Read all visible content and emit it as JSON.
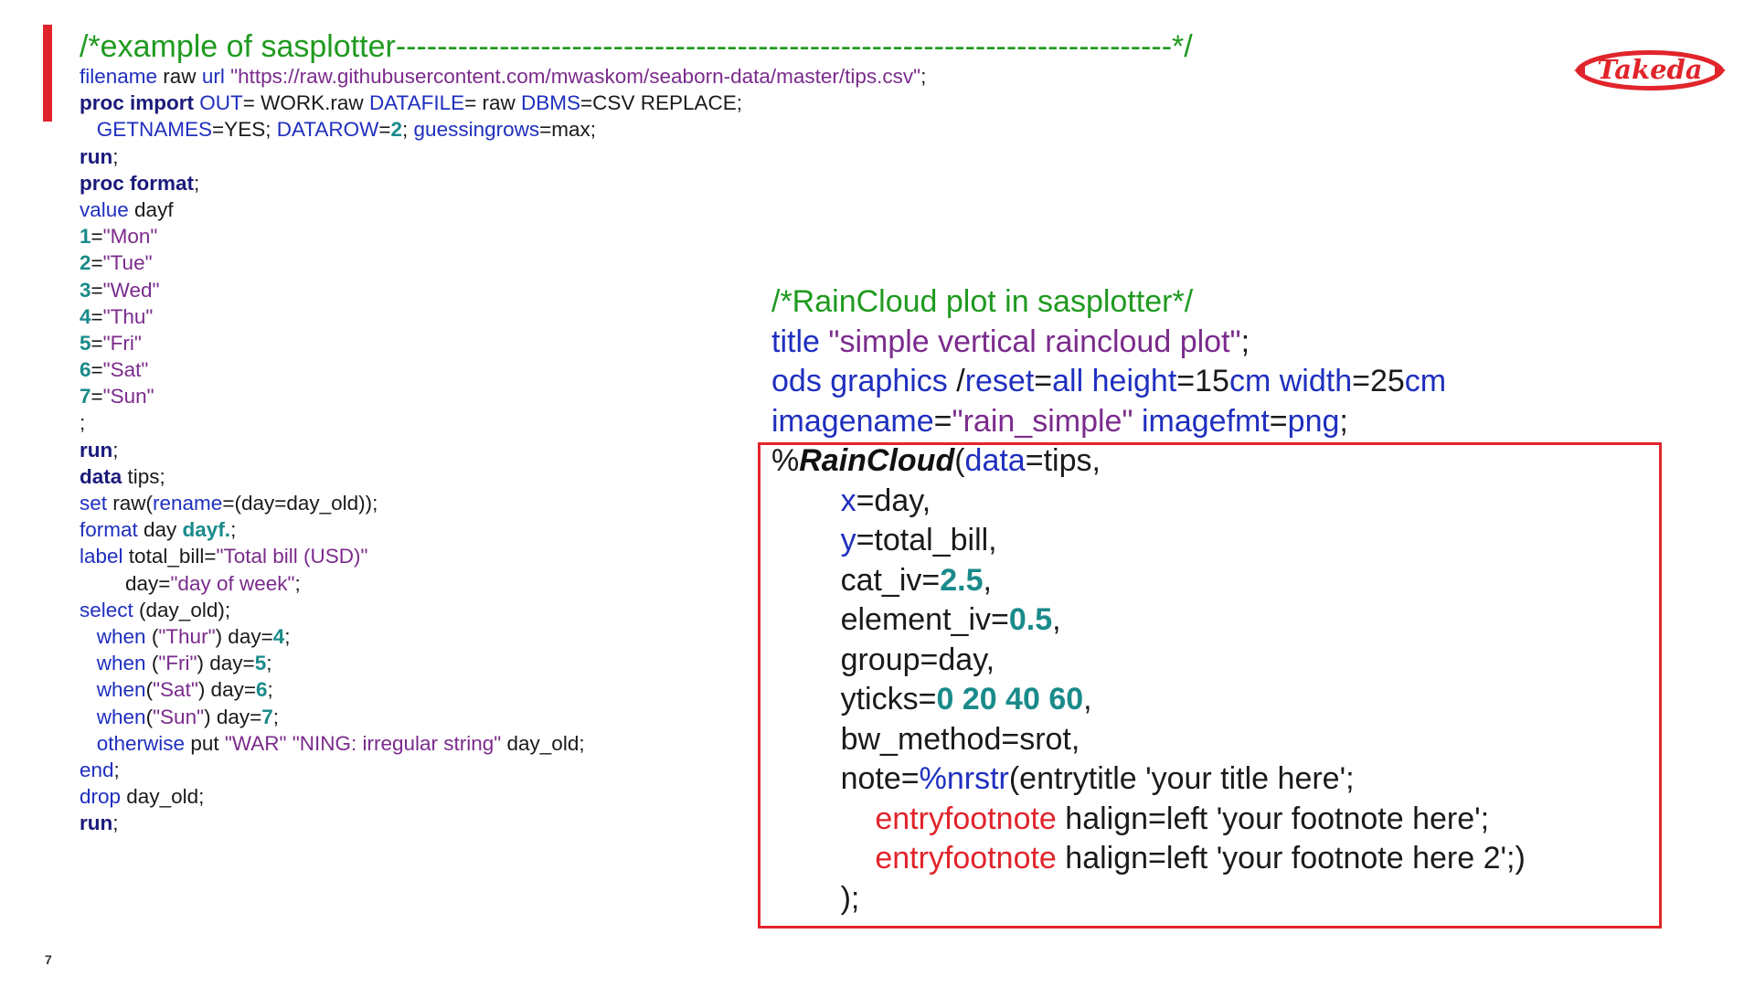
{
  "page": {
    "number": "7",
    "logo_text": "Takeda",
    "colors": {
      "accent": "#e1242b",
      "keyword": "#1f2fbf",
      "bold_keyword": "#1a1a7a",
      "string": "#7b2b8c",
      "number": "#1a8a8a",
      "comment": "#1f9a1f"
    }
  },
  "left_code": [
    {
      "size": "title",
      "tokens": [
        {
          "c": "com",
          "t": "/*example of sasplotter---------------------------------------------------------------------------*/"
        }
      ]
    },
    {
      "tokens": [
        {
          "c": "kw",
          "t": "filename"
        },
        {
          "c": "txt",
          "t": " raw "
        },
        {
          "c": "kw",
          "t": "url"
        },
        {
          "c": "txt",
          "t": " "
        },
        {
          "c": "str",
          "t": "\"https://raw.githubusercontent.com/mwaskom/seaborn-data/master/tips.csv\""
        },
        {
          "c": "txt",
          "t": ";"
        }
      ]
    },
    {
      "tokens": [
        {
          "c": "kb",
          "t": "proc import"
        },
        {
          "c": "txt",
          "t": " "
        },
        {
          "c": "kw",
          "t": "OUT"
        },
        {
          "c": "txt",
          "t": "= WORK.raw "
        },
        {
          "c": "kw",
          "t": "DATAFILE"
        },
        {
          "c": "txt",
          "t": "= raw "
        },
        {
          "c": "kw",
          "t": "DBMS"
        },
        {
          "c": "txt",
          "t": "=CSV REPLACE;"
        }
      ]
    },
    {
      "tokens": [
        {
          "c": "txt",
          "t": "   "
        },
        {
          "c": "kw",
          "t": "GETNAMES"
        },
        {
          "c": "txt",
          "t": "=YES; "
        },
        {
          "c": "kw",
          "t": "DATAROW"
        },
        {
          "c": "txt",
          "t": "="
        },
        {
          "c": "num",
          "t": "2"
        },
        {
          "c": "txt",
          "t": "; "
        },
        {
          "c": "kw",
          "t": "guessingrows"
        },
        {
          "c": "txt",
          "t": "=max;"
        }
      ]
    },
    {
      "tokens": [
        {
          "c": "kb",
          "t": "run"
        },
        {
          "c": "txt",
          "t": ";"
        }
      ]
    },
    {
      "tokens": [
        {
          "c": "kb",
          "t": "proc format"
        },
        {
          "c": "txt",
          "t": ";"
        }
      ]
    },
    {
      "tokens": [
        {
          "c": "kw",
          "t": "value"
        },
        {
          "c": "txt",
          "t": " dayf"
        }
      ]
    },
    {
      "tokens": [
        {
          "c": "num",
          "t": "1"
        },
        {
          "c": "txt",
          "t": "="
        },
        {
          "c": "str",
          "t": "\"Mon\""
        }
      ]
    },
    {
      "tokens": [
        {
          "c": "num",
          "t": "2"
        },
        {
          "c": "txt",
          "t": "="
        },
        {
          "c": "str",
          "t": "\"Tue\""
        }
      ]
    },
    {
      "tokens": [
        {
          "c": "num",
          "t": "3"
        },
        {
          "c": "txt",
          "t": "="
        },
        {
          "c": "str",
          "t": "\"Wed\""
        }
      ]
    },
    {
      "tokens": [
        {
          "c": "num",
          "t": "4"
        },
        {
          "c": "txt",
          "t": "="
        },
        {
          "c": "str",
          "t": "\"Thu\""
        }
      ]
    },
    {
      "tokens": [
        {
          "c": "num",
          "t": "5"
        },
        {
          "c": "txt",
          "t": "="
        },
        {
          "c": "str",
          "t": "\"Fri\""
        }
      ]
    },
    {
      "tokens": [
        {
          "c": "num",
          "t": "6"
        },
        {
          "c": "txt",
          "t": "="
        },
        {
          "c": "str",
          "t": "\"Sat\""
        }
      ]
    },
    {
      "tokens": [
        {
          "c": "num",
          "t": "7"
        },
        {
          "c": "txt",
          "t": "="
        },
        {
          "c": "str",
          "t": "\"Sun\""
        }
      ]
    },
    {
      "tokens": [
        {
          "c": "txt",
          "t": ";"
        }
      ]
    },
    {
      "tokens": [
        {
          "c": "kb",
          "t": "run"
        },
        {
          "c": "txt",
          "t": ";"
        }
      ]
    },
    {
      "tokens": [
        {
          "c": "kb",
          "t": "data"
        },
        {
          "c": "txt",
          "t": " tips;"
        }
      ]
    },
    {
      "tokens": [
        {
          "c": "kw",
          "t": "set"
        },
        {
          "c": "txt",
          "t": " raw("
        },
        {
          "c": "kw",
          "t": "rename"
        },
        {
          "c": "txt",
          "t": "=(day=day_old));"
        }
      ]
    },
    {
      "tokens": [
        {
          "c": "kw",
          "t": "format"
        },
        {
          "c": "txt",
          "t": " day "
        },
        {
          "c": "num",
          "t": "dayf."
        },
        {
          "c": "txt",
          "t": ";"
        }
      ]
    },
    {
      "tokens": [
        {
          "c": "kw",
          "t": "label"
        },
        {
          "c": "txt",
          "t": " total_bill="
        },
        {
          "c": "str",
          "t": "\"Total bill (USD)\""
        }
      ]
    },
    {
      "tokens": [
        {
          "c": "txt",
          "t": "        day="
        },
        {
          "c": "str",
          "t": "\"day of week\""
        },
        {
          "c": "txt",
          "t": ";"
        }
      ]
    },
    {
      "tokens": [
        {
          "c": "kw",
          "t": "select"
        },
        {
          "c": "txt",
          "t": " (day_old);"
        }
      ]
    },
    {
      "tokens": [
        {
          "c": "txt",
          "t": "   "
        },
        {
          "c": "kw",
          "t": "when"
        },
        {
          "c": "txt",
          "t": " ("
        },
        {
          "c": "str",
          "t": "\"Thur\""
        },
        {
          "c": "txt",
          "t": ") day="
        },
        {
          "c": "num",
          "t": "4"
        },
        {
          "c": "txt",
          "t": ";"
        }
      ]
    },
    {
      "tokens": [
        {
          "c": "txt",
          "t": "   "
        },
        {
          "c": "kw",
          "t": "when"
        },
        {
          "c": "txt",
          "t": " ("
        },
        {
          "c": "str",
          "t": "\"Fri\""
        },
        {
          "c": "txt",
          "t": ") day="
        },
        {
          "c": "num",
          "t": "5"
        },
        {
          "c": "txt",
          "t": ";"
        }
      ]
    },
    {
      "tokens": [
        {
          "c": "txt",
          "t": "   "
        },
        {
          "c": "kw",
          "t": "when"
        },
        {
          "c": "txt",
          "t": "("
        },
        {
          "c": "str",
          "t": "\"Sat\""
        },
        {
          "c": "txt",
          "t": ") day="
        },
        {
          "c": "num",
          "t": "6"
        },
        {
          "c": "txt",
          "t": ";"
        }
      ]
    },
    {
      "tokens": [
        {
          "c": "txt",
          "t": "   "
        },
        {
          "c": "kw",
          "t": "when"
        },
        {
          "c": "txt",
          "t": "("
        },
        {
          "c": "str",
          "t": "\"Sun\""
        },
        {
          "c": "txt",
          "t": ") day="
        },
        {
          "c": "num",
          "t": "7"
        },
        {
          "c": "txt",
          "t": ";"
        }
      ]
    },
    {
      "tokens": [
        {
          "c": "txt",
          "t": "   "
        },
        {
          "c": "kw",
          "t": "otherwise"
        },
        {
          "c": "txt",
          "t": " put "
        },
        {
          "c": "str",
          "t": "\"WAR\" \"NING: irregular string\""
        },
        {
          "c": "txt",
          "t": " day_old;"
        }
      ]
    },
    {
      "tokens": [
        {
          "c": "kw",
          "t": "end"
        },
        {
          "c": "txt",
          "t": ";"
        }
      ]
    },
    {
      "tokens": [
        {
          "c": "kw",
          "t": "drop"
        },
        {
          "c": "txt",
          "t": " day_old;"
        }
      ]
    },
    {
      "tokens": [
        {
          "c": "kb",
          "t": "run"
        },
        {
          "c": "txt",
          "t": ";"
        }
      ]
    }
  ],
  "right_code": [
    {
      "tokens": [
        {
          "c": "com",
          "t": "/*RainCloud plot in sasplotter*/"
        }
      ]
    },
    {
      "tokens": [
        {
          "c": "kw",
          "t": "title"
        },
        {
          "c": "txt",
          "t": " "
        },
        {
          "c": "str",
          "t": "\"simple vertical raincloud plot\""
        },
        {
          "c": "txt",
          "t": ";"
        }
      ]
    },
    {
      "tokens": [
        {
          "c": "kw",
          "t": "ods graphics"
        },
        {
          "c": "txt",
          "t": " /"
        },
        {
          "c": "kw",
          "t": "reset"
        },
        {
          "c": "txt",
          "t": "="
        },
        {
          "c": "kw",
          "t": "all"
        },
        {
          "c": "txt",
          "t": " "
        },
        {
          "c": "kw",
          "t": "height"
        },
        {
          "c": "txt",
          "t": "=15"
        },
        {
          "c": "kw",
          "t": "cm"
        },
        {
          "c": "txt",
          "t": " "
        },
        {
          "c": "kw",
          "t": "width"
        },
        {
          "c": "txt",
          "t": "=25"
        },
        {
          "c": "kw",
          "t": "cm"
        }
      ]
    },
    {
      "tokens": [
        {
          "c": "kw",
          "t": "imagename"
        },
        {
          "c": "txt",
          "t": "="
        },
        {
          "c": "str",
          "t": "\"rain_simple\""
        },
        {
          "c": "txt",
          "t": " "
        },
        {
          "c": "kw",
          "t": "imagefmt"
        },
        {
          "c": "txt",
          "t": "="
        },
        {
          "c": "kw",
          "t": "png"
        },
        {
          "c": "txt",
          "t": ";"
        }
      ]
    },
    {
      "tokens": [
        {
          "c": "txt",
          "t": "%"
        },
        {
          "c": "macro",
          "t": "RainCloud"
        },
        {
          "c": "txt",
          "t": "("
        },
        {
          "c": "kw",
          "t": "data"
        },
        {
          "c": "txt",
          "t": "=tips,"
        }
      ]
    },
    {
      "tokens": [
        {
          "c": "txt",
          "t": "        "
        },
        {
          "c": "kw",
          "t": "x"
        },
        {
          "c": "txt",
          "t": "=day,"
        }
      ]
    },
    {
      "tokens": [
        {
          "c": "txt",
          "t": "        "
        },
        {
          "c": "kw",
          "t": "y"
        },
        {
          "c": "txt",
          "t": "=total_bill,"
        }
      ]
    },
    {
      "tokens": [
        {
          "c": "txt",
          "t": "        cat_iv="
        },
        {
          "c": "num",
          "t": "2.5"
        },
        {
          "c": "txt",
          "t": ","
        }
      ]
    },
    {
      "tokens": [
        {
          "c": "txt",
          "t": "        element_iv="
        },
        {
          "c": "num",
          "t": "0.5"
        },
        {
          "c": "txt",
          "t": ","
        }
      ]
    },
    {
      "tokens": [
        {
          "c": "txt",
          "t": "        group=day,"
        }
      ]
    },
    {
      "tokens": [
        {
          "c": "txt",
          "t": "        yticks="
        },
        {
          "c": "num",
          "t": "0 20 40 60"
        },
        {
          "c": "txt",
          "t": ","
        }
      ]
    },
    {
      "tokens": [
        {
          "c": "txt",
          "t": "        bw_method=srot,"
        }
      ]
    },
    {
      "tokens": [
        {
          "c": "txt",
          "t": "        note="
        },
        {
          "c": "kw",
          "t": "%nrstr"
        },
        {
          "c": "txt",
          "t": "(entrytitle 'your title here';"
        }
      ]
    },
    {
      "tokens": [
        {
          "c": "txt",
          "t": "            "
        },
        {
          "c": "red",
          "t": "entryfootnote"
        },
        {
          "c": "txt",
          "t": " halign=left 'your footnote here';"
        }
      ]
    },
    {
      "tokens": [
        {
          "c": "txt",
          "t": "            "
        },
        {
          "c": "red",
          "t": "entryfootnote"
        },
        {
          "c": "txt",
          "t": " halign=left 'your footnote here 2';)"
        }
      ]
    },
    {
      "tokens": [
        {
          "c": "txt",
          "t": "        );"
        }
      ]
    }
  ]
}
